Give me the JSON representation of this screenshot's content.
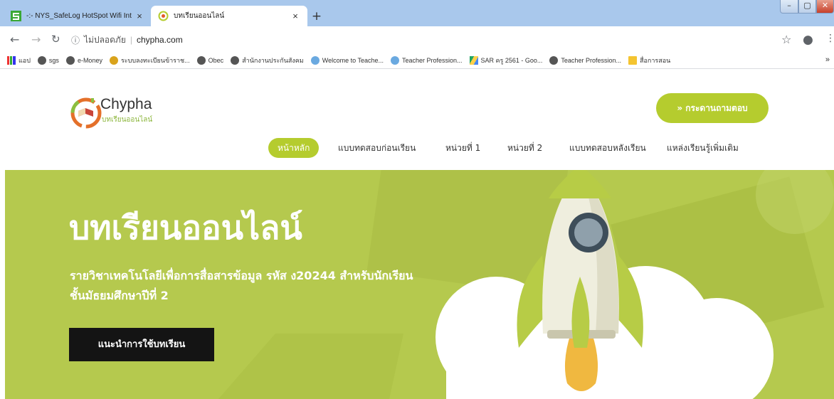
{
  "browser": {
    "tabs": [
      {
        "title": "-:- NYS_SafeLog HotSpot Wifi Int",
        "close": "×"
      },
      {
        "title": "บทเรียนออนไลน์",
        "close": "×"
      }
    ],
    "new_tab": "+",
    "window_controls": {
      "minimize": "–",
      "maximize": "▢",
      "close": "✕"
    },
    "address": {
      "security_label": "ไม่ปลอดภัย",
      "separator": "|",
      "url": "chypha.com"
    },
    "bookmarks": [
      "แอป",
      "sgs",
      "e-Money",
      "ระบบลงทะเบียนข้าราช...",
      "Obec",
      "สำนักงานประกันสังคม",
      "Welcome to Teache...",
      "Teacher Profession...",
      "SAR ครู 2561 - Goo...",
      "Teacher Profession...",
      "สื่อการสอน"
    ],
    "bookmarks_more": "»"
  },
  "site": {
    "logo_title": "Chypha",
    "logo_subtitle": "บทเรียนออนไลน์",
    "cta_label": "» กระดานถามตอบ",
    "nav": [
      "หน้าหลัก",
      "แบบทดสอบก่อนเรียน",
      "หน่วยที่ 1",
      "หน่วยที่ 2",
      "แบบทดสอบหลังเรียน",
      "แหล่งเรียนรู้เพิ่มเติม"
    ]
  },
  "hero": {
    "title": "บทเรียนออนไลน์",
    "subtitle": "รายวิชาเทคโนโลยีเพื่อการสื่อสารข้อมูล รหัส ง20244 สำหรับนักเรียนชั้นมัธยมศึกษาปีที่ 2",
    "button_label": "แนะนำการใช้บทเรียน"
  },
  "colors": {
    "accent": "#b5cc2e",
    "hero_bg": "#b5c94e",
    "button_dark": "#141414",
    "chrome": "#a9c8ec"
  }
}
